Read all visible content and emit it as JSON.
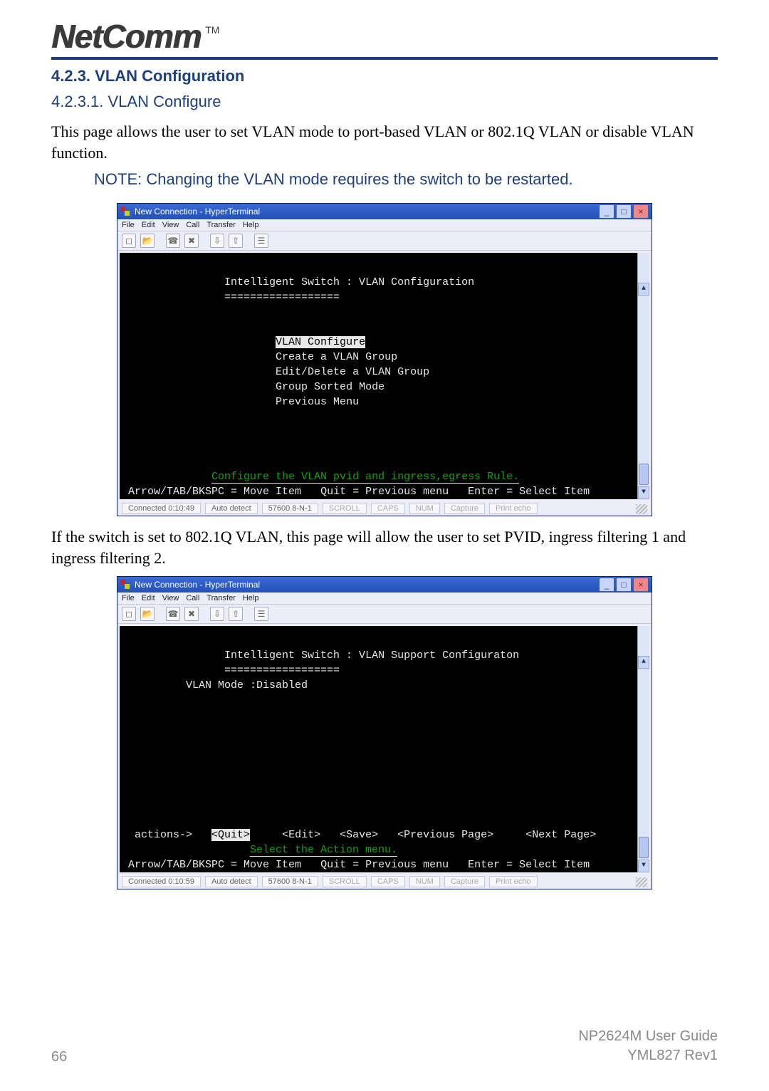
{
  "logo": {
    "text": "NetComm",
    "tm": "TM"
  },
  "headings": {
    "h1": "4.2.3. VLAN Configuration",
    "h2": "4.2.3.1. VLAN Configure"
  },
  "para1": "This page allows the user to set VLAN mode to port-based VLAN or 802.1Q VLAN or disable VLAN function.",
  "note": "NOTE: Changing the VLAN mode requires the switch to be restarted.",
  "para2": "If the switch is set to 802.1Q VLAN, this page will allow the user to set PVID, ingress filtering 1 and ingress filtering 2.",
  "window_title": "New Connection - HyperTerminal",
  "menu": [
    "File",
    "Edit",
    "View",
    "Call",
    "Transfer",
    "Help"
  ],
  "toolbar_icons": [
    "new-doc-icon",
    "open-icon",
    "connect-icon",
    "disconnect-icon",
    "sep",
    "send-icon",
    "receive-icon",
    "sep",
    "properties-icon"
  ],
  "term1": {
    "header": "Intelligent Switch : VLAN Configuration",
    "divider": "==================",
    "menu_selected": "VLAN Configure",
    "menu_items": [
      "Create a VLAN Group",
      "Edit/Delete a VLAN Group",
      "Group Sorted Mode",
      "Previous Menu"
    ],
    "hint_green": "Configure the VLAN pvid and ingress,egress Rule.",
    "nav_a": "Arrow/TAB/BKSPC = Move Item",
    "nav_b": "Quit = Previous menu",
    "nav_c": "Enter = Select Item"
  },
  "term2": {
    "header": "Intelligent Switch : VLAN Support Configuraton",
    "divider": "==================",
    "mode_line": "VLAN Mode :Disabled",
    "actions_label": "actions->",
    "action_selected": "<Quit>",
    "actions_rest": [
      "<Edit>",
      "<Save>",
      "<Previous Page>",
      "<Next Page>"
    ],
    "hint_green": "Select the Action menu.",
    "nav_a": "Arrow/TAB/BKSPC = Move Item",
    "nav_b": "Quit = Previous menu",
    "nav_c": "Enter = Select Item"
  },
  "status1": {
    "connected": "Connected 0:10:49",
    "detect": "Auto detect",
    "params": "57600 8-N-1",
    "fields": [
      "SCROLL",
      "CAPS",
      "NUM",
      "Capture",
      "Print echo"
    ]
  },
  "status2": {
    "connected": "Connected 0:10:59",
    "detect": "Auto detect",
    "params": "57600 8-N-1",
    "fields": [
      "SCROLL",
      "CAPS",
      "NUM",
      "Capture",
      "Print echo"
    ]
  },
  "footer": {
    "page": "66",
    "doc1": "NP2624M User Guide",
    "doc2": "YML827 Rev1"
  },
  "winctrl": {
    "min": "_",
    "max": "□",
    "close": "×"
  },
  "scroll": {
    "up": "▲",
    "down": "▼"
  }
}
